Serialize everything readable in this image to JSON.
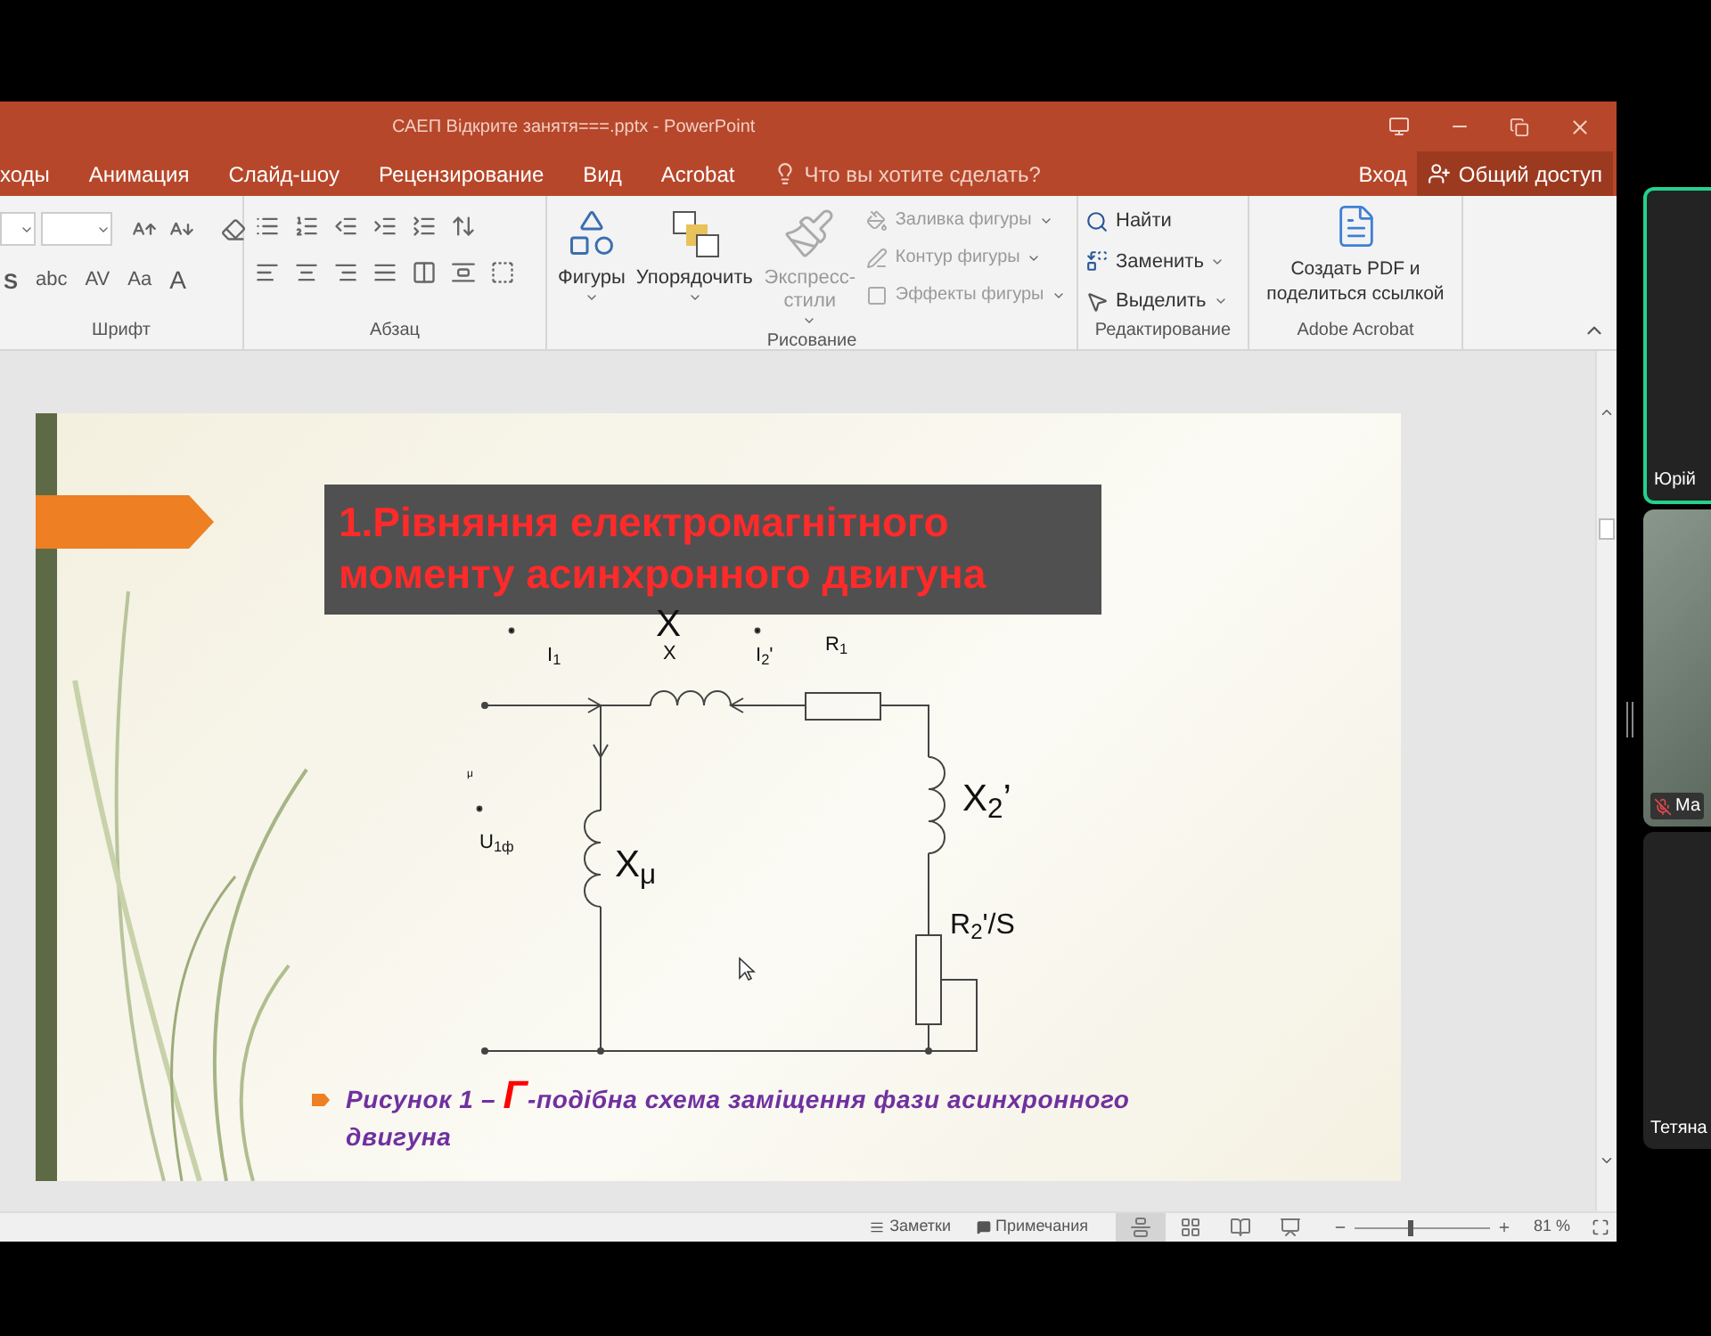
{
  "window": {
    "title": "САЕП Відкрите занятя===.pptx - PowerPoint"
  },
  "tabs": [
    {
      "label": "ходы"
    },
    {
      "label": "Анимация"
    },
    {
      "label": "Слайд-шоу"
    },
    {
      "label": "Рецензирование"
    },
    {
      "label": "Вид"
    },
    {
      "label": "Acrobat"
    }
  ],
  "tell_me": {
    "placeholder": "Что вы хотите сделать?"
  },
  "sign_in": "Вход",
  "share": "Общий доступ",
  "ribbon": {
    "font": {
      "label": "Шрифт",
      "buttons": [
        {
          "label": "S"
        },
        {
          "label": "abc"
        },
        {
          "label": "AV"
        },
        {
          "label": "Aa"
        },
        {
          "label": "A"
        }
      ]
    },
    "paragraph": {
      "label": "Абзац"
    },
    "drawing": {
      "label": "Рисование",
      "big": [
        {
          "kind": "shapes",
          "label": "Фигуры",
          "disabled": false
        },
        {
          "kind": "arrange",
          "label": "Упорядочить",
          "disabled": false
        },
        {
          "kind": "styles",
          "label": "Экспресс-стили",
          "disabled": true
        }
      ],
      "small": [
        {
          "kind": "fill",
          "label": "Заливка фигуры",
          "disabled": true
        },
        {
          "kind": "outline",
          "label": "Контур фигуры",
          "disabled": true
        },
        {
          "kind": "effects",
          "label": "Эффекты фигуры",
          "disabled": true
        }
      ]
    },
    "editing": {
      "label": "Редактирование",
      "items": [
        {
          "kind": "find",
          "label": "Найти",
          "dropdown": false
        },
        {
          "kind": "replace",
          "label": "Заменить",
          "dropdown": true
        },
        {
          "kind": "select",
          "label": "Выделить",
          "dropdown": true
        }
      ]
    },
    "acrobat": {
      "label": "Adobe Acrobat",
      "button": "Создать PDF и поделиться ссылкой"
    }
  },
  "slide": {
    "title": "1.Рівняння електромагнітного моменту асинхронного двигуна",
    "labels": [
      {
        "text": "I$_{1}$",
        "kind": "small"
      },
      {
        "text": "X",
        "kind": "big"
      },
      {
        "text": "X",
        "kind": "small"
      },
      {
        "text": "I$_{2}$'",
        "kind": "small"
      },
      {
        "text": "R$_{1}$",
        "kind": "small"
      },
      {
        "text": "X$_{2}$’",
        "kind": "big"
      },
      {
        "text": "X$_{μ}$",
        "kind": "big"
      },
      {
        "text": "U$_{1ф}$",
        "kind": "small"
      },
      {
        "text": "μ",
        "kind": "tiny"
      },
      {
        "text": "R$_{2}$'/S",
        "kind": "mid"
      }
    ],
    "caption": {
      "before": "Рисунок 1 – ",
      "emphasis": "Г",
      "after": "-подібна схема заміщення фази асинхронного двигуна"
    }
  },
  "status_bar": {
    "notes": "Заметки",
    "comments": "Примечания",
    "views": [
      {
        "kind": "normal",
        "selected": true
      },
      {
        "kind": "sorter",
        "selected": false
      },
      {
        "kind": "reading",
        "selected": false
      },
      {
        "kind": "show",
        "selected": false
      }
    ],
    "zoom": {
      "level": 0.4,
      "reading": "81 %"
    }
  },
  "participants": [
    {
      "name": "Юрій",
      "speaking": true,
      "video": false,
      "muted": false
    },
    {
      "name": "Ма",
      "speaking": false,
      "video": true,
      "muted": true
    },
    {
      "name": "Тетяна",
      "speaking": false,
      "video": false,
      "muted": false
    }
  ]
}
